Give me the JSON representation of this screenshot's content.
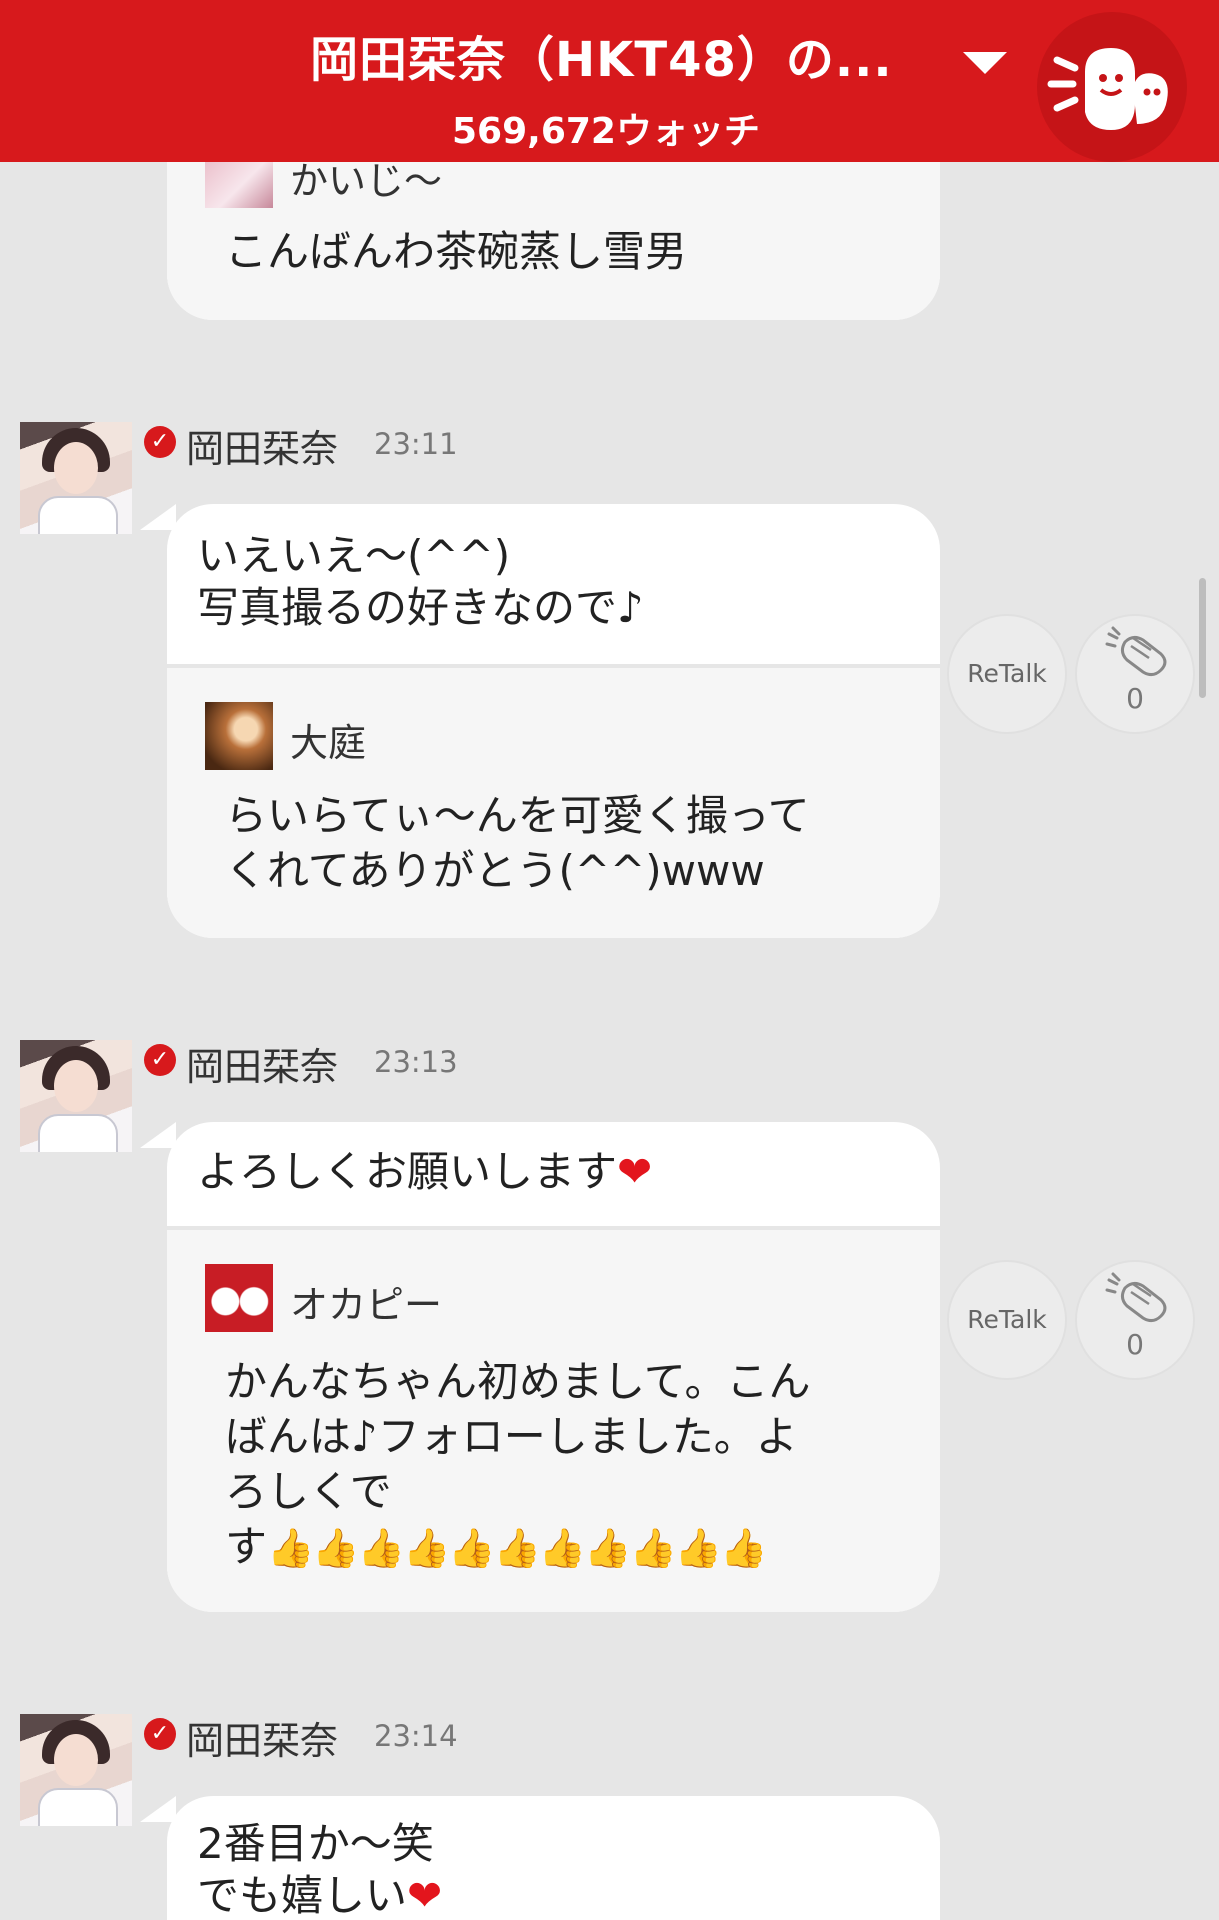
{
  "header": {
    "title": "岡田栞奈（HKT48）の...",
    "watch_count": "569,672ウォッチ"
  },
  "colors": {
    "header_bg": "#d7191c",
    "background": "#e6e6e6",
    "bubble": "#ffffff",
    "quote_bg": "#f6f6f6",
    "thumbs": "#f1a52a"
  },
  "top_bubble": {
    "quoted_name": "かいじ～",
    "quoted_text": "こんばんわ茶碗蒸し雪男"
  },
  "messages": [
    {
      "sender": "岡田栞奈",
      "time": "23:11",
      "text": "いえいえ～(^^)\n写真撮るの好きなので♪",
      "quoted_name": "大庭",
      "quoted_text": "らいらてぃ～んを可愛く撮って\nくれてありがとう(^^)www",
      "retalk_label": "ReTalk",
      "clap_count": "0"
    },
    {
      "sender": "岡田栞奈",
      "time": "23:13",
      "text": "よろしくお願いします",
      "heart": "❤",
      "quoted_name": "オカピー",
      "quoted_text": "かんなちゃん初めまして。こん\nばんは♪フォローしました。よ\nろしくで\nす",
      "quoted_emoji": "👍👍👍👍👍👍👍👍👍👍👍",
      "retalk_label": "ReTalk",
      "clap_count": "0"
    },
    {
      "sender": "岡田栞奈",
      "time": "23:14",
      "text": "2番目か～笑\nでも嬉しい",
      "heart": "❤"
    }
  ],
  "icons": {
    "verified": "check-circle-icon",
    "clap": "clap-icon",
    "dropdown": "triangle-down-icon",
    "logo": "ghost-logo-icon"
  },
  "verified_mark": "✓"
}
